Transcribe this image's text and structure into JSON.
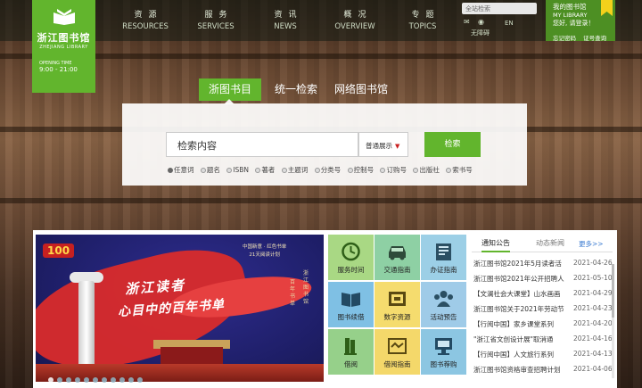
{
  "logo": {
    "cn": "浙江图书馆",
    "en": "ZHEJIANG LIBRARY",
    "opening_label": "OPENING TIME",
    "hours": "9:00 - 21:00"
  },
  "nav": [
    {
      "zh": "资源",
      "en": "RESOURCES"
    },
    {
      "zh": "服务",
      "en": "SERVICES"
    },
    {
      "zh": "资讯",
      "en": "NEWS"
    },
    {
      "zh": "概况",
      "en": "OVERVIEW"
    },
    {
      "zh": "专题",
      "en": "TOPICS"
    }
  ],
  "header": {
    "search_placeholder": "全站检索",
    "accessibility": "无障碍",
    "lang": "EN"
  },
  "mylib": {
    "title": "我的图书馆",
    "title_en": "MY LIBRARY",
    "greeting": "您好, 请登录！",
    "link_forgot": "忘记密码",
    "link_card": "证号查询"
  },
  "search_tabs": [
    "浙图书目",
    "统一检索",
    "网络图书馆"
  ],
  "search": {
    "placeholder": "检索内容",
    "mode": "普通展示",
    "button": "检索",
    "fields": [
      "任意词",
      "题名",
      "ISBN",
      "著者",
      "主题词",
      "分类号",
      "控制号",
      "订购号",
      "出版社",
      "索书号"
    ]
  },
  "banner": {
    "badge": "100",
    "title": "浙江读者",
    "subtitle": "心目中的百年书单",
    "tag_line1": "中国新意 · 红色书单",
    "tag_line2": "21天阅读计划",
    "vertical1": "浙江图书馆",
    "vertical2": "百年书单"
  },
  "services": [
    {
      "label": "服务时间",
      "icon": "clock-icon",
      "bg": "#a9d884"
    },
    {
      "label": "交通指南",
      "icon": "car-icon",
      "bg": "#8ed0a4"
    },
    {
      "label": "办证指南",
      "icon": "card-icon",
      "bg": "#9ccfe6"
    },
    {
      "label": "图书续借",
      "icon": "book-icon",
      "bg": "#7fc0e4"
    },
    {
      "label": "数字资源",
      "icon": "folder-icon",
      "bg": "#f5dc6e"
    },
    {
      "label": "活动预告",
      "icon": "people-icon",
      "bg": "#9fcbe8"
    },
    {
      "label": "借阅",
      "icon": "book-stack-icon",
      "bg": "#96d08a"
    },
    {
      "label": "借阅指南",
      "icon": "handshake-icon",
      "bg": "#f4d86a"
    },
    {
      "label": "图书荐购",
      "icon": "monitor-icon",
      "bg": "#8cc6e2"
    }
  ],
  "notices": {
    "tab_active": "通知公告",
    "tab_other": "动态新闻",
    "more": "更多>>",
    "items": [
      {
        "title": "浙江图书馆2021年5月读者活",
        "date": "2021-04-26"
      },
      {
        "title": "浙江图书馆2021年公开招聘人",
        "date": "2021-05-10"
      },
      {
        "title": "【文澜社会大课堂】山水画画",
        "date": "2021-04-29"
      },
      {
        "title": "浙江图书馆关于2021年劳动节",
        "date": "2021-04-23"
      },
      {
        "title": "【行阅中国】家乡课堂系列",
        "date": "2021-04-20"
      },
      {
        "title": "\"浙江省文创设计展\"取消通",
        "date": "2021-04-16"
      },
      {
        "title": "【行阅中国】人文旅行系列",
        "date": "2021-04-13"
      },
      {
        "title": "浙江图书馆资格审查招聘计划",
        "date": "2021-04-06"
      }
    ]
  },
  "colors": {
    "brand_green": "#62b52d",
    "dark_green": "#4d8f23",
    "flag_yellow": "#f3d11b",
    "link_blue": "#3b7bd1"
  }
}
